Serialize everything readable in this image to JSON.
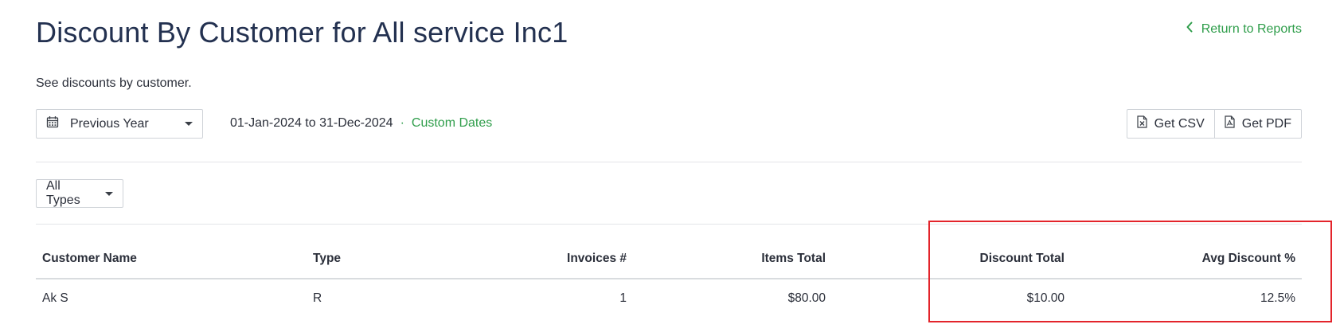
{
  "header": {
    "title": "Discount By Customer for All service Inc1",
    "return_link": "Return to Reports",
    "subtitle": "See discounts by customer."
  },
  "filters": {
    "period_label": "Previous Year",
    "date_range": "01-Jan-2024 to 31-Dec-2024",
    "separator": "·",
    "custom_dates": "Custom Dates",
    "types_label": "All Types"
  },
  "actions": {
    "csv_label": "Get CSV",
    "pdf_label": "Get PDF"
  },
  "table": {
    "headers": {
      "customer": "Customer Name",
      "type": "Type",
      "invoices": "Invoices #",
      "items_total": "Items Total",
      "discount_total": "Discount Total",
      "avg_discount": "Avg Discount %"
    },
    "rows": [
      {
        "customer": "Ak S",
        "type": "R",
        "invoices": "1",
        "items_total": "$80.00",
        "discount_total": "$10.00",
        "avg_discount": "12.5%"
      }
    ]
  },
  "colors": {
    "accent_green": "#2e9d4a",
    "title_navy": "#233150",
    "highlight_red": "#e3242b"
  },
  "icons": [
    "chevron-left-icon",
    "calendar-icon",
    "caret-down-icon",
    "csv-file-icon",
    "pdf-file-icon"
  ]
}
